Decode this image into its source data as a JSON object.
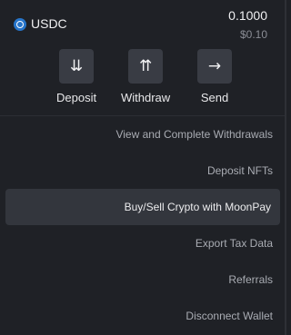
{
  "token": {
    "icon": "usdc-coin-icon",
    "symbol": "USDC",
    "amount": "0.1000",
    "usd_value": "$0.10"
  },
  "actions": [
    {
      "label": "Deposit",
      "glyph": "⇊",
      "icon": "deposit-arrows-down-icon"
    },
    {
      "label": "Withdraw",
      "glyph": "⇈",
      "icon": "withdraw-arrows-up-icon"
    },
    {
      "label": "Send",
      "glyph": "→",
      "icon": "send-arrow-right-icon"
    }
  ],
  "menu": {
    "items": [
      {
        "label": "View and Complete Withdrawals"
      },
      {
        "label": "Deposit NFTs"
      },
      {
        "label": "Buy/Sell Crypto with MoonPay",
        "highlighted": true
      },
      {
        "label": "Export Tax Data"
      },
      {
        "label": "Referrals"
      },
      {
        "label": "Disconnect Wallet"
      }
    ]
  },
  "colors": {
    "background": "#1f2126",
    "button": "#393c44",
    "highlight": "#33363d",
    "usdc_blue": "#2775ca"
  }
}
